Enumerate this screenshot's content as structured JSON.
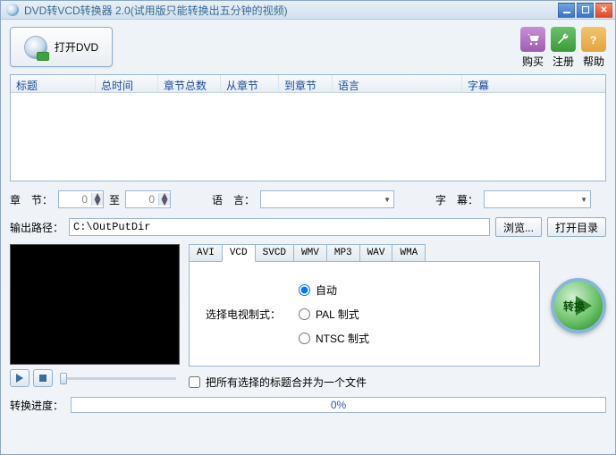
{
  "window": {
    "title": "DVD转VCD转换器 2.0(试用版只能转换出五分钟的视频)"
  },
  "toolbar": {
    "open_dvd": "打开DVD",
    "buy": "购买",
    "register": "注册",
    "help": "帮助"
  },
  "grid": {
    "columns": [
      "标题",
      "总时间",
      "章节总数",
      "从章节",
      "到章节",
      "语言",
      "字幕"
    ]
  },
  "chapter": {
    "label": "章　节：",
    "from": "0",
    "to_label": "至",
    "to": "0",
    "lang_label": "语　言：",
    "sub_label": "字　幕："
  },
  "output": {
    "label": "输出路径：",
    "path": "C:\\OutPutDir",
    "browse": "浏览...",
    "open_dir": "打开目录"
  },
  "tabs": [
    "AVI",
    "VCD",
    "SVCD",
    "WMV",
    "MP3",
    "WAV",
    "WMA"
  ],
  "active_tab": 1,
  "settings": {
    "tv_label": "选择电视制式：",
    "options": {
      "auto": "自动",
      "pal": "PAL  制式",
      "ntsc": "NTSC 制式"
    }
  },
  "merge_label": "把所有选择的标题合并为一个文件",
  "convert_label": "转换",
  "progress": {
    "label": "转换进度：",
    "pct": "0%"
  }
}
